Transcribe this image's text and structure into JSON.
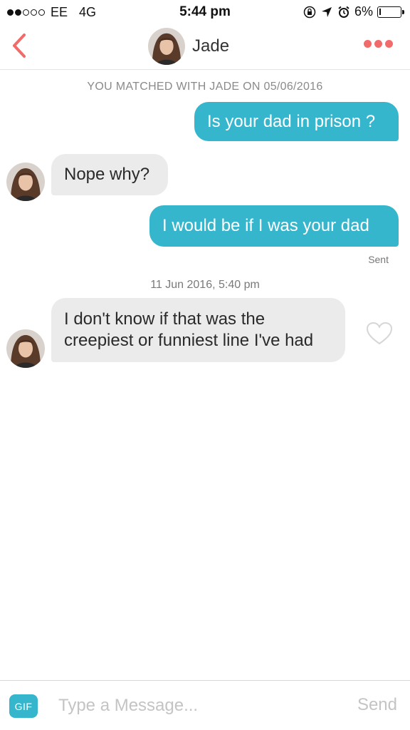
{
  "status_bar": {
    "carrier": "EE",
    "network": "4G",
    "signal_bars_filled": 2,
    "signal_bars_total": 5,
    "time": "5:44 pm",
    "battery_percent_label": "6%",
    "battery_level": 0.06,
    "icons": [
      "lock-rotation-icon",
      "location-arrow-icon",
      "alarm-icon",
      "battery-icon"
    ]
  },
  "header": {
    "contact_name": "Jade",
    "back_icon": "chevron-left-icon",
    "more_icon": "more-dots-icon",
    "accent_color": "#f26b6b"
  },
  "chat": {
    "match_notice": "YOU MATCHED WITH JADE ON 05/06/2016",
    "messages": [
      {
        "direction": "outgoing",
        "text": "Is your dad in prison ?"
      },
      {
        "direction": "incoming",
        "text": "Nope why?"
      },
      {
        "direction": "outgoing",
        "text": "I would be if I was your dad"
      },
      {
        "direction": "incoming",
        "lines": [
          "I don't know if that was the",
          "creepiest or funniest line I've had"
        ]
      }
    ],
    "sent_label": "Sent",
    "timestamp": "11 Jun 2016, 5:40 pm",
    "outgoing_color": "#36b6cc",
    "incoming_color": "#ebebeb"
  },
  "composer": {
    "gif_label": "GIF",
    "placeholder": "Type a Message...",
    "value": "",
    "send_label": "Send"
  }
}
